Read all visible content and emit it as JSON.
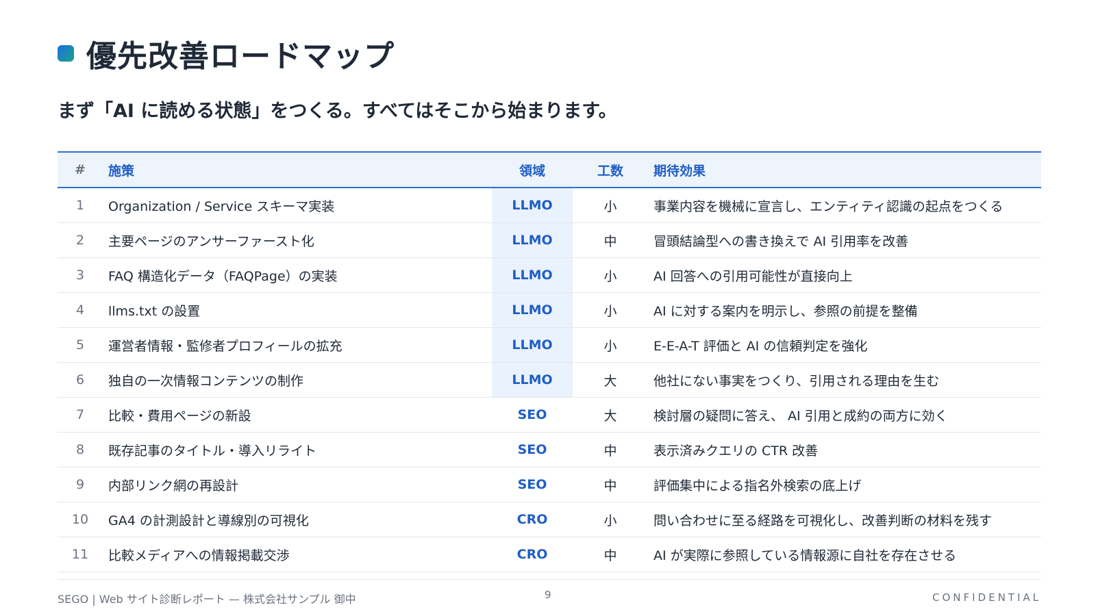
{
  "page": {
    "title": "優先改善ロードマップ",
    "subtitle": "まず「AI に読める状態」をつくる。すべてはそこから始まります。"
  },
  "table": {
    "headers": {
      "num": "#",
      "item": "施策",
      "area": "領域",
      "effort": "工数",
      "effect": "期待効果"
    },
    "rows": [
      {
        "num": "1",
        "item": "Organization / Service スキーマ実装",
        "area": "LLMO",
        "effort": "小",
        "effect": "事業内容を機械に宣言し、エンティティ認識の起点をつくる"
      },
      {
        "num": "2",
        "item": "主要ページのアンサーファースト化",
        "area": "LLMO",
        "effort": "中",
        "effect": "冒頭結論型への書き換えで AI 引用率を改善"
      },
      {
        "num": "3",
        "item": "FAQ 構造化データ（FAQPage）の実装",
        "area": "LLMO",
        "effort": "小",
        "effect": "AI 回答への引用可能性が直接向上"
      },
      {
        "num": "4",
        "item": "llms.txt の設置",
        "area": "LLMO",
        "effort": "小",
        "effect": "AI に対する案内を明示し、参照の前提を整備"
      },
      {
        "num": "5",
        "item": "運営者情報・監修者プロフィールの拡充",
        "area": "LLMO",
        "effort": "小",
        "effect": "E-E-A-T 評価と AI の信頼判定を強化"
      },
      {
        "num": "6",
        "item": "独自の一次情報コンテンツの制作",
        "area": "LLMO",
        "effort": "大",
        "effect": "他社にない事実をつくり、引用される理由を生む"
      },
      {
        "num": "7",
        "item": "比較・費用ページの新設",
        "area": "SEO",
        "effort": "大",
        "effect": "検討層の疑問に答え、 AI 引用と成約の両方に効く"
      },
      {
        "num": "8",
        "item": "既存記事のタイトル・導入リライト",
        "area": "SEO",
        "effort": "中",
        "effect": "表示済みクエリの CTR 改善"
      },
      {
        "num": "9",
        "item": "内部リンク網の再設計",
        "area": "SEO",
        "effort": "中",
        "effect": "評価集中による指名外検索の底上げ"
      },
      {
        "num": "10",
        "item": "GA4 の計測設計と導線別の可視化",
        "area": "CRO",
        "effort": "小",
        "effect": "問い合わせに至る経路を可視化し、改善判断の材料を残す"
      },
      {
        "num": "11",
        "item": "比較メディアへの情報掲載交渉",
        "area": "CRO",
        "effort": "中",
        "effect": "AI が実際に参照している情報源に自社を存在させる"
      }
    ]
  },
  "footer": {
    "left": "SEGO | Web サイト診断レポート — 株式会社サンプル 御中",
    "page_number": "9",
    "right": "CONFIDENTIAL"
  },
  "colors": {
    "accent": "#1f5fc4",
    "header_bg": "#eef4fc",
    "llmo_bg": "#eaf2fd"
  },
  "icons": {
    "title_marker": "gradient-square-icon"
  }
}
